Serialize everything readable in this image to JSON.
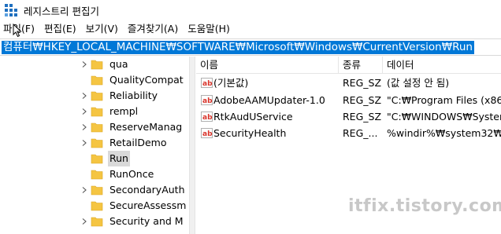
{
  "window": {
    "title": "레지스트리 편집기"
  },
  "menu": [
    "파일(F)",
    "편집(E)",
    "보기(V)",
    "즐겨찾기(A)",
    "도움말(H)"
  ],
  "address": "컴퓨터₩HKEY_LOCAL_MACHINE₩SOFTWARE₩Microsoft₩Windows₩CurrentVersion₩Run",
  "tree": {
    "items": [
      {
        "label": "qua",
        "expandable": true
      },
      {
        "label": "QualityCompat",
        "expandable": false
      },
      {
        "label": "Reliability",
        "expandable": true
      },
      {
        "label": "rempl",
        "expandable": true
      },
      {
        "label": "ReserveManag",
        "expandable": true
      },
      {
        "label": "RetailDemo",
        "expandable": true
      },
      {
        "label": "Run",
        "expandable": false,
        "selected": true
      },
      {
        "label": "RunOnce",
        "expandable": false
      },
      {
        "label": "SecondaryAuth",
        "expandable": true
      },
      {
        "label": "SecureAssessm",
        "expandable": false
      },
      {
        "label": "Security and M",
        "expandable": true
      }
    ]
  },
  "values": {
    "columns": {
      "name": "이름",
      "type": "종류",
      "data": "데이터"
    },
    "rows": [
      {
        "name": "(기본값)",
        "type": "REG_SZ",
        "data": "(값 설정 안 됨)"
      },
      {
        "name": "AdobeAAMUpdater-1.0",
        "type": "REG_SZ",
        "data": "\"C:₩Program Files (x86)₩"
      },
      {
        "name": "RtkAudUService",
        "type": "REG_SZ",
        "data": "\"C:₩WINDOWS₩System3"
      },
      {
        "name": "SecurityHealth",
        "type": "REG_...",
        "data": "%windir%₩system32₩Se"
      }
    ]
  },
  "watermark": "itfix.tistory.com",
  "colors": {
    "selection": "#0078d7",
    "folder": "#f5c542",
    "value_icon": "#d9342b"
  }
}
